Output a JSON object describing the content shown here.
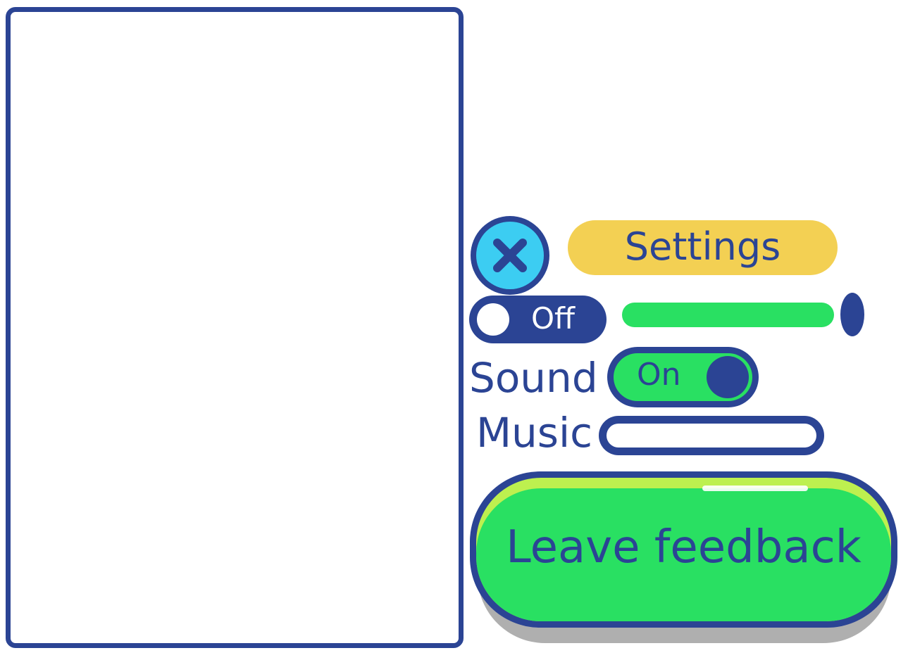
{
  "colors": {
    "outline": "#2b4494",
    "close_fill": "#3ccdf2",
    "settings_fill": "#f3d053",
    "green": "#29e062",
    "highlight": "#bdf04f",
    "shadow": "#afafaf"
  },
  "close_button": {
    "icon": "close-icon"
  },
  "header": {
    "title": "Settings"
  },
  "first_toggle": {
    "state_label": "Off"
  },
  "first_slider": {
    "level": 1.0
  },
  "sound": {
    "label": "Sound",
    "state_label": "On"
  },
  "music": {
    "label": "Music",
    "level": 0.0
  },
  "feedback_button": {
    "label": "Leave feedback"
  }
}
